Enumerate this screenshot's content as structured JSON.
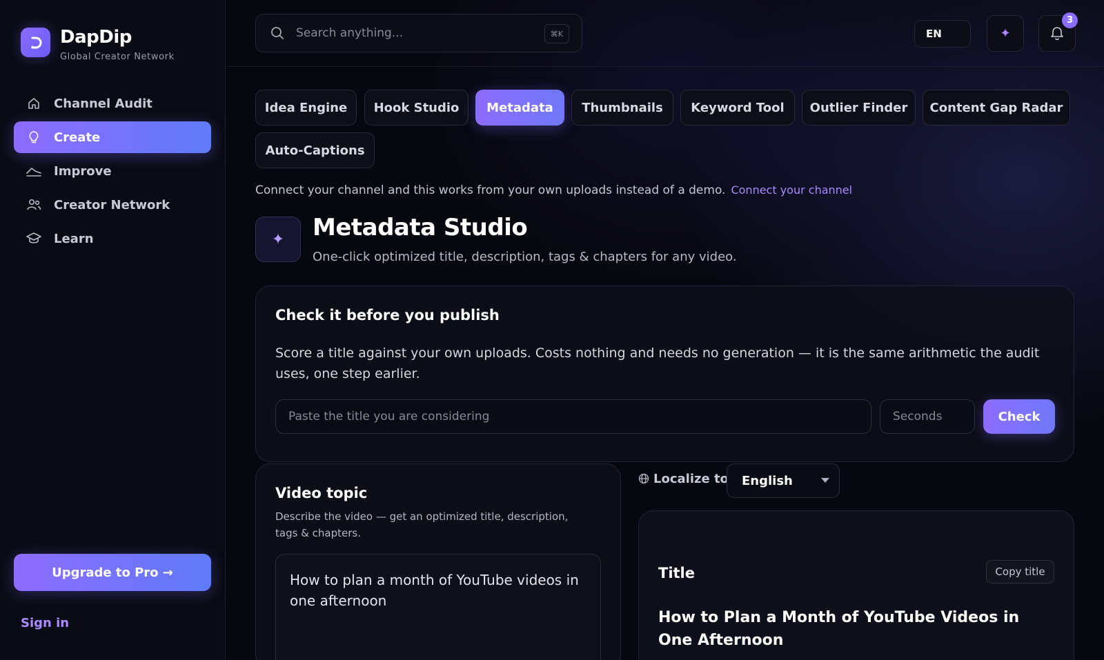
{
  "brand": {
    "name": "DapDip",
    "tagline": "Global Creator Network",
    "logo_glyph": "⊃"
  },
  "sidebar": {
    "items": [
      {
        "label": "Channel Audit",
        "icon": "home-icon",
        "active": false
      },
      {
        "label": "Create",
        "icon": "lightbulb-icon",
        "active": true
      },
      {
        "label": "Improve",
        "icon": "chart-icon",
        "active": false
      },
      {
        "label": "Creator Network",
        "icon": "users-icon",
        "active": false
      },
      {
        "label": "Learn",
        "icon": "graduation-cap-icon",
        "active": false
      }
    ],
    "upgrade_label": "Upgrade to Pro →",
    "signin_label": "Sign in"
  },
  "topbar": {
    "search_placeholder": "Search anything...",
    "shortcut": "⌘K",
    "lang": "EN",
    "notification_count": "3"
  },
  "tabs": [
    {
      "label": "Idea Engine",
      "active": false
    },
    {
      "label": "Hook Studio",
      "active": false
    },
    {
      "label": "Metadata",
      "active": true
    },
    {
      "label": "Thumbnails",
      "active": false
    },
    {
      "label": "Keyword Tool",
      "active": false
    },
    {
      "label": "Outlier Finder",
      "active": false
    },
    {
      "label": "Content Gap Radar",
      "active": false
    },
    {
      "label": "Auto-Captions",
      "active": false
    }
  ],
  "notice": {
    "text": "Connect your channel and this works from your own uploads instead of a demo.",
    "link": "Connect your channel"
  },
  "studio": {
    "title": "Metadata Studio",
    "subtitle": "One-click optimized title, description, tags & chapters for any video."
  },
  "check": {
    "title": "Check it before you publish",
    "description": "Score a title against your own uploads. Costs nothing and needs no generation — it is the same arithmetic the audit uses, one step earlier.",
    "title_placeholder": "Paste the title you are considering",
    "seconds_placeholder": "Seconds",
    "button": "Check"
  },
  "topic": {
    "title": "Video topic",
    "description": "Describe the video — get an optimized title, description, tags & chapters.",
    "value": "How to plan a month of YouTube videos in one afternoon"
  },
  "localize": {
    "label": "Localize to",
    "selected": "English"
  },
  "result": {
    "label": "Title",
    "copy_button": "Copy title",
    "value": "How to Plan a Month of YouTube Videos in One Afternoon"
  },
  "colors": {
    "accent": "#8d6cff",
    "accent2": "#5f7af8",
    "background": "#07070f",
    "link": "#a98aff"
  }
}
